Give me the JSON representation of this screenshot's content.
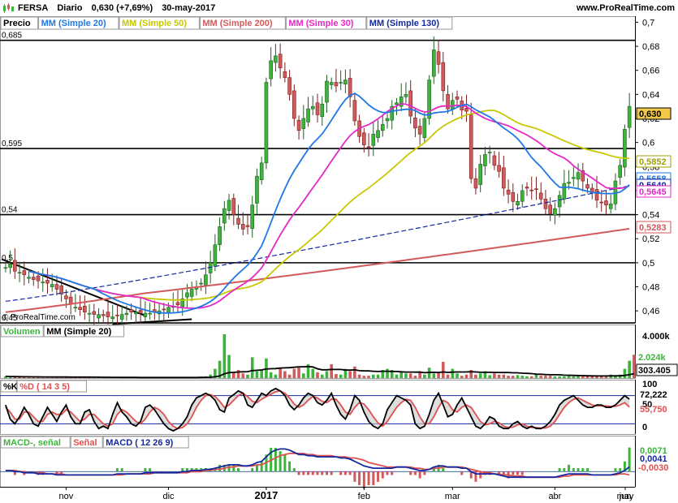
{
  "header": {
    "ticker": "FERSA",
    "period": "Diario",
    "last_quote": "0,630 (+7,69%)",
    "date": "30-may-2017",
    "site": "www.ProRealTime.com"
  },
  "price_panel": {
    "legend": [
      {
        "text": "Precio",
        "color": "#000000"
      },
      {
        "text": "MM (Simple 20)",
        "color": "#1e78e6"
      },
      {
        "text": "MM (Simple 50)",
        "color": "#c8c800"
      },
      {
        "text": "MM (Simple 200)",
        "color": "#d25a5a"
      },
      {
        "text": "MM (Simple 30)",
        "color": "#e628c8"
      },
      {
        "text": "MM (Simple 130)",
        "color": "#1428a0"
      }
    ],
    "watermark": "© ProRealTime.com",
    "y_ticks": [
      "0,7",
      "0,68",
      "0,66",
      "0,64",
      "0,62",
      "0,6",
      "0,58",
      "0,56",
      "0,54",
      "0,52",
      "0,5",
      "0,48",
      "0,46"
    ],
    "level_labels": [
      "0,685",
      "0,595",
      "0,54",
      "0,5",
      "0,45"
    ],
    "value_badges": [
      {
        "text": "0,630",
        "color": "#000000",
        "bg": "#f0c84a"
      },
      {
        "text": "0,5852",
        "color": "#a0a000",
        "bg": "#ffffff"
      },
      {
        "text": "0,5658",
        "color": "#1e78e6",
        "bg": "#ffffff"
      },
      {
        "text": "0,5640",
        "color": "#1428a0",
        "bg": "#ffffff"
      },
      {
        "text": "0,5645",
        "color": "#e628c8",
        "bg": "#ffffff"
      },
      {
        "text": "0,5283",
        "color": "#d25a5a",
        "bg": "#ffffff"
      }
    ]
  },
  "volume_panel": {
    "legend": [
      {
        "text": "Volumen",
        "color": "#3cb43c"
      },
      {
        "text": "MM (Simple 20)",
        "color": "#000000"
      }
    ],
    "y_ticks": [
      "4.000k"
    ],
    "value_badges": [
      {
        "text": "2.024k",
        "color": "#3cb43c"
      },
      {
        "text": "303.405",
        "color": "#000000"
      }
    ]
  },
  "stoch_panel": {
    "legend": [
      {
        "text": "%K",
        "color": "#000000"
      },
      {
        "text": "%D ( 14 3 5)",
        "color": "#e05050"
      }
    ],
    "y_ticks": [
      "100",
      "50",
      "0"
    ],
    "value_badges": [
      {
        "text": "72,222",
        "color": "#000000"
      },
      {
        "text": "55,750",
        "color": "#e05050"
      }
    ]
  },
  "macd_panel": {
    "legend": [
      {
        "text": "MACD-, señal",
        "color": "#3cb43c"
      },
      {
        "text": "Señal",
        "color": "#e05050"
      },
      {
        "text": "MACD ( 12 26 9)",
        "color": "#1428a0"
      }
    ],
    "value_badges": [
      {
        "text": "0,0071",
        "color": "#3cb43c"
      },
      {
        "text": "0,0041",
        "color": "#1428a0"
      },
      {
        "text": "-0,0030",
        "color": "#e05050"
      }
    ]
  },
  "x_axis": [
    "nov",
    "dic",
    "2017",
    "feb",
    "mar",
    "abr",
    "may",
    "jun"
  ],
  "chart_data": [
    {
      "type": "candlestick",
      "ylim": [
        0.45,
        0.705
      ],
      "horizontal_levels": [
        0.685,
        0.595,
        0.54,
        0.5,
        0.45
      ],
      "closes": [
        0.496,
        0.499,
        0.493,
        0.492,
        0.49,
        0.488,
        0.486,
        0.485,
        0.484,
        0.483,
        0.482,
        0.478,
        0.474,
        0.47,
        0.466,
        0.463,
        0.461,
        0.459,
        0.458,
        0.457,
        0.457,
        0.456,
        0.455,
        0.455,
        0.456,
        0.457,
        0.458,
        0.459,
        0.459,
        0.458,
        0.458,
        0.458,
        0.459,
        0.46,
        0.461,
        0.463,
        0.464,
        0.465,
        0.47,
        0.475,
        0.478,
        0.48,
        0.483,
        0.49,
        0.5,
        0.515,
        0.53,
        0.545,
        0.552,
        0.54,
        0.532,
        0.528,
        0.53,
        0.548,
        0.572,
        0.583,
        0.65,
        0.668,
        0.672,
        0.662,
        0.654,
        0.64,
        0.62,
        0.61,
        0.62,
        0.628,
        0.63,
        0.623,
        0.632,
        0.651,
        0.65,
        0.647,
        0.65,
        0.652,
        0.638,
        0.618,
        0.605,
        0.598,
        0.596,
        0.607,
        0.61,
        0.615,
        0.62,
        0.63,
        0.633,
        0.638,
        0.64,
        0.622,
        0.612,
        0.607,
        0.62,
        0.652,
        0.677,
        0.665,
        0.643,
        0.628,
        0.635,
        0.636,
        0.627,
        0.626,
        0.57,
        0.562,
        0.582,
        0.59,
        0.592,
        0.581,
        0.576,
        0.562,
        0.557,
        0.551,
        0.551,
        0.56,
        0.562,
        0.56,
        0.561,
        0.553,
        0.545,
        0.541,
        0.545,
        0.556,
        0.566,
        0.567,
        0.571,
        0.575,
        0.568,
        0.562,
        0.558,
        0.552,
        0.55,
        0.548,
        0.549,
        0.568,
        0.581,
        0.611,
        0.63
      ],
      "ma20_last": 0.5658,
      "ma50_last": 0.5852,
      "ma200_last": 0.5283,
      "ma30_last": 0.5645,
      "ma130_last": 0.564
    },
    {
      "type": "bar",
      "title": "Volumen",
      "ylim": [
        0,
        4500
      ],
      "unit": "k",
      "values": [
        150,
        120,
        110,
        100,
        95,
        90,
        85,
        80,
        80,
        75,
        70,
        70,
        65,
        65,
        60,
        60,
        60,
        55,
        55,
        50,
        50,
        45,
        45,
        45,
        40,
        40,
        40,
        40,
        40,
        40,
        40,
        40,
        45,
        45,
        50,
        55,
        60,
        60,
        60,
        70,
        80,
        100,
        120,
        150,
        300,
        800,
        1500,
        3800,
        2000,
        500,
        700,
        400,
        300,
        1800,
        600,
        700,
        1700,
        500,
        300,
        900,
        600,
        300,
        800,
        1000,
        400,
        1200,
        800,
        500,
        300,
        600,
        1200,
        350,
        300,
        800,
        600,
        1000,
        300,
        200,
        200,
        300,
        300,
        700,
        800,
        700,
        300,
        600,
        400,
        400,
        200,
        600,
        300,
        900,
        400,
        500,
        1400,
        300,
        800,
        400,
        200,
        300,
        700,
        300,
        400,
        600,
        250,
        400,
        300,
        300,
        200,
        200,
        250,
        200,
        150,
        150,
        300,
        200,
        200,
        200,
        150,
        150,
        150,
        200,
        150,
        200,
        150,
        200,
        150,
        150,
        200,
        200,
        300,
        250,
        300,
        800,
        1500,
        2024
      ],
      "ma20_last": 303.405
    },
    {
      "type": "line",
      "title": "%K / %D ( 14 3 5)",
      "ylim": [
        0,
        100
      ],
      "k": [
        60,
        30,
        20,
        35,
        55,
        40,
        20,
        15,
        35,
        55,
        40,
        25,
        45,
        60,
        35,
        20,
        20,
        45,
        50,
        25,
        10,
        15,
        10,
        40,
        65,
        45,
        35,
        20,
        15,
        25,
        55,
        60,
        50,
        35,
        20,
        10,
        5,
        10,
        20,
        35,
        60,
        75,
        80,
        85,
        80,
        70,
        50,
        45,
        75,
        82,
        90,
        85,
        60,
        55,
        70,
        85,
        80,
        90,
        95,
        90,
        80,
        60,
        50,
        60,
        75,
        85,
        80,
        65,
        60,
        70,
        85,
        60,
        40,
        30,
        50,
        80,
        70,
        45,
        25,
        15,
        10,
        20,
        50,
        65,
        80,
        75,
        70,
        60,
        20,
        10,
        15,
        40,
        70,
        85,
        60,
        35,
        40,
        60,
        75,
        55,
        35,
        15,
        10,
        20,
        35,
        30,
        15,
        10,
        10,
        20,
        25,
        15,
        10,
        15,
        10,
        10,
        15,
        25,
        40,
        60,
        70,
        75,
        80,
        70,
        60,
        55,
        55,
        60,
        60,
        55,
        55,
        60,
        70,
        80,
        72.222
      ],
      "d": [
        55,
        45,
        30,
        30,
        45,
        45,
        35,
        25,
        25,
        40,
        45,
        40,
        40,
        50,
        45,
        35,
        25,
        30,
        40,
        40,
        30,
        20,
        15,
        20,
        40,
        50,
        45,
        35,
        25,
        20,
        30,
        45,
        55,
        50,
        40,
        25,
        15,
        10,
        12,
        20,
        35,
        55,
        70,
        80,
        82,
        78,
        68,
        55,
        60,
        70,
        80,
        85,
        78,
        68,
        65,
        72,
        78,
        83,
        88,
        90,
        85,
        75,
        62,
        55,
        60,
        70,
        78,
        75,
        68,
        65,
        72,
        72,
        60,
        45,
        40,
        55,
        65,
        62,
        50,
        35,
        22,
        15,
        25,
        40,
        55,
        65,
        72,
        70,
        55,
        35,
        20,
        20,
        35,
        55,
        70,
        65,
        50,
        45,
        55,
        60,
        55,
        40,
        25,
        18,
        20,
        25,
        22,
        15,
        12,
        13,
        18,
        20,
        15,
        12,
        12,
        11,
        11,
        15,
        25,
        40,
        55,
        65,
        72,
        75,
        70,
        65,
        60,
        58,
        58,
        58,
        57,
        57,
        60,
        65,
        55.75
      ]
    },
    {
      "type": "line",
      "title": "MACD ( 12 26 9)",
      "ylim": [
        -0.012,
        0.026
      ],
      "macd": [
        0.001,
        0.001,
        0.0,
        0.0,
        -0.001,
        -0.001,
        -0.001,
        -0.002,
        -0.002,
        -0.002,
        -0.002,
        -0.003,
        -0.003,
        -0.003,
        -0.003,
        -0.003,
        -0.003,
        -0.003,
        -0.003,
        -0.003,
        -0.003,
        -0.003,
        -0.003,
        -0.003,
        -0.002,
        -0.002,
        -0.002,
        -0.002,
        -0.002,
        -0.002,
        -0.001,
        -0.001,
        -0.001,
        -0.001,
        -0.001,
        -0.001,
        -0.001,
        -0.001,
        0.0,
        0.0,
        0.001,
        0.001,
        0.001,
        0.002,
        0.002,
        0.003,
        0.004,
        0.005,
        0.006,
        0.006,
        0.006,
        0.005,
        0.005,
        0.006,
        0.008,
        0.009,
        0.013,
        0.017,
        0.019,
        0.02,
        0.02,
        0.019,
        0.017,
        0.015,
        0.015,
        0.014,
        0.014,
        0.013,
        0.013,
        0.013,
        0.013,
        0.013,
        0.012,
        0.012,
        0.011,
        0.009,
        0.007,
        0.005,
        0.004,
        0.003,
        0.003,
        0.003,
        0.003,
        0.003,
        0.004,
        0.004,
        0.004,
        0.003,
        0.002,
        0.001,
        0.001,
        0.002,
        0.004,
        0.005,
        0.005,
        0.004,
        0.004,
        0.004,
        0.003,
        0.003,
        0.0,
        -0.002,
        -0.002,
        -0.002,
        -0.002,
        -0.002,
        -0.003,
        -0.004,
        -0.005,
        -0.005,
        -0.005,
        -0.005,
        -0.005,
        -0.005,
        -0.005,
        -0.005,
        -0.005,
        -0.005,
        -0.005,
        -0.004,
        -0.003,
        -0.002,
        -0.002,
        -0.002,
        -0.002,
        -0.002,
        -0.003,
        -0.003,
        -0.003,
        -0.003,
        -0.003,
        -0.002,
        -0.001,
        0.001,
        0.0041
      ],
      "signal": [
        0.001,
        0.001,
        0.001,
        0.0,
        0.0,
        -0.001,
        -0.001,
        -0.001,
        -0.001,
        -0.002,
        -0.002,
        -0.002,
        -0.002,
        -0.003,
        -0.003,
        -0.003,
        -0.003,
        -0.003,
        -0.003,
        -0.003,
        -0.003,
        -0.003,
        -0.003,
        -0.003,
        -0.003,
        -0.003,
        -0.002,
        -0.002,
        -0.002,
        -0.002,
        -0.002,
        -0.002,
        -0.001,
        -0.001,
        -0.001,
        -0.001,
        -0.001,
        -0.001,
        -0.001,
        -0.001,
        0.0,
        0.0,
        0.0,
        0.001,
        0.001,
        0.002,
        0.002,
        0.003,
        0.004,
        0.004,
        0.005,
        0.005,
        0.005,
        0.005,
        0.006,
        0.006,
        0.008,
        0.01,
        0.012,
        0.014,
        0.015,
        0.016,
        0.016,
        0.016,
        0.016,
        0.015,
        0.015,
        0.014,
        0.014,
        0.014,
        0.014,
        0.013,
        0.013,
        0.013,
        0.012,
        0.012,
        0.011,
        0.01,
        0.008,
        0.007,
        0.006,
        0.005,
        0.004,
        0.004,
        0.004,
        0.004,
        0.004,
        0.004,
        0.003,
        0.003,
        0.002,
        0.002,
        0.003,
        0.003,
        0.004,
        0.004,
        0.004,
        0.004,
        0.004,
        0.003,
        0.002,
        0.001,
        0.0,
        -0.001,
        -0.001,
        -0.002,
        -0.002,
        -0.003,
        -0.003,
        -0.004,
        -0.004,
        -0.004,
        -0.005,
        -0.005,
        -0.005,
        -0.005,
        -0.005,
        -0.005,
        -0.005,
        -0.005,
        -0.004,
        -0.004,
        -0.003,
        -0.003,
        -0.003,
        -0.003,
        -0.003,
        -0.003,
        -0.003,
        -0.003,
        -0.003,
        -0.003,
        -0.002,
        -0.002,
        -0.003
      ]
    }
  ]
}
